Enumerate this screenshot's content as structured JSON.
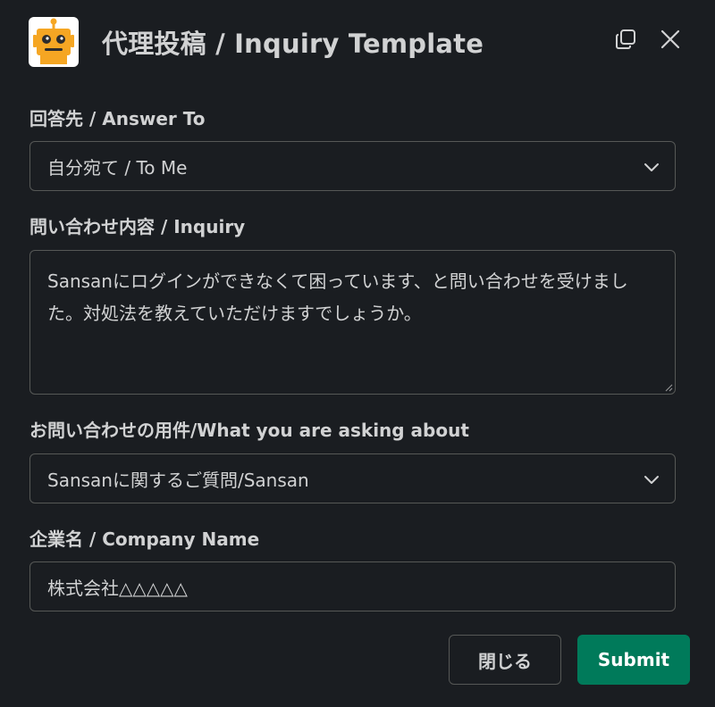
{
  "modal": {
    "title": "代理投稿 / Inquiry Template",
    "avatar_icon": "robot-icon",
    "actions": {
      "open_new_window_icon": "copy-window-icon",
      "close_icon": "close-icon"
    }
  },
  "form": {
    "answer_to": {
      "label": "回答先 / Answer To",
      "selected": "自分宛て / To Me"
    },
    "inquiry": {
      "label": "問い合わせ内容 / Inquiry",
      "value": "Sansanにログインができなくて困っています、と問い合わせを受けました。対処法を教えていただけますでしょうか。"
    },
    "topic": {
      "label": "お問い合わせの用件/What you are asking about",
      "selected": "Sansanに関するご質問/Sansan"
    },
    "company": {
      "label": "企業名 / Company Name",
      "value": "株式会社△△△△△"
    }
  },
  "footer": {
    "close_label": "閉じる",
    "submit_label": "Submit"
  },
  "colors": {
    "background": "#1a1d21",
    "text": "#d1d2d3",
    "border": "#565856",
    "submit": "#007a5a",
    "avatar_orange": "#f5a623"
  }
}
